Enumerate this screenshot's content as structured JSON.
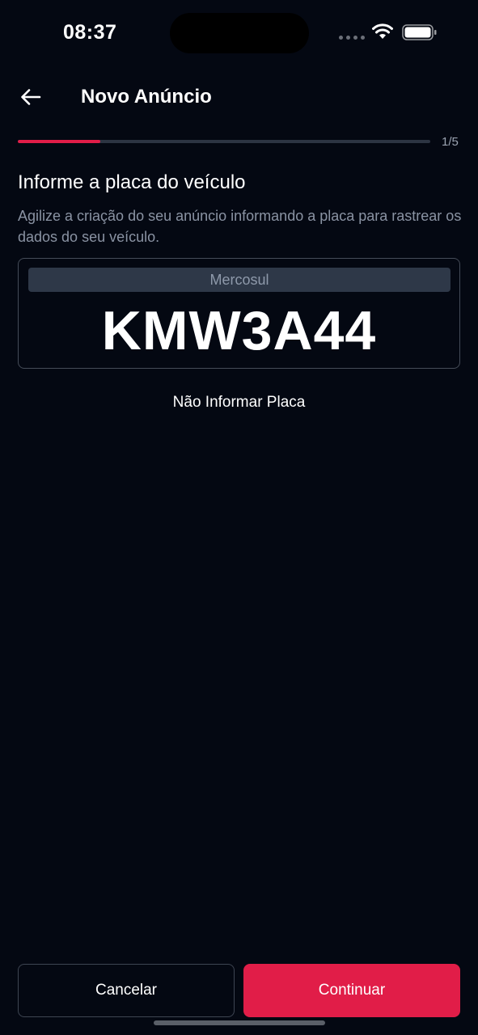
{
  "status_bar": {
    "time": "08:37",
    "icons": [
      "signal-icon",
      "wifi-icon",
      "battery-icon"
    ]
  },
  "header": {
    "title": "Novo Anúncio",
    "back_icon": "arrow-left-icon"
  },
  "progress": {
    "label": "1/5",
    "fraction": 0.2,
    "color": "#e11d48"
  },
  "content": {
    "title": "Informe a placa do veículo",
    "description": "Agilize a criação do seu anúncio informando a placa para rastrear os dados do seu veículo."
  },
  "plate": {
    "type_label": "Mercosul",
    "number": "KMW3A44"
  },
  "skip_label": "Não Informar Placa",
  "footer": {
    "cancel_label": "Cancelar",
    "continue_label": "Continuar"
  },
  "colors": {
    "background": "#040812",
    "accent": "#e11d48",
    "muted_text": "#8a93a3"
  }
}
